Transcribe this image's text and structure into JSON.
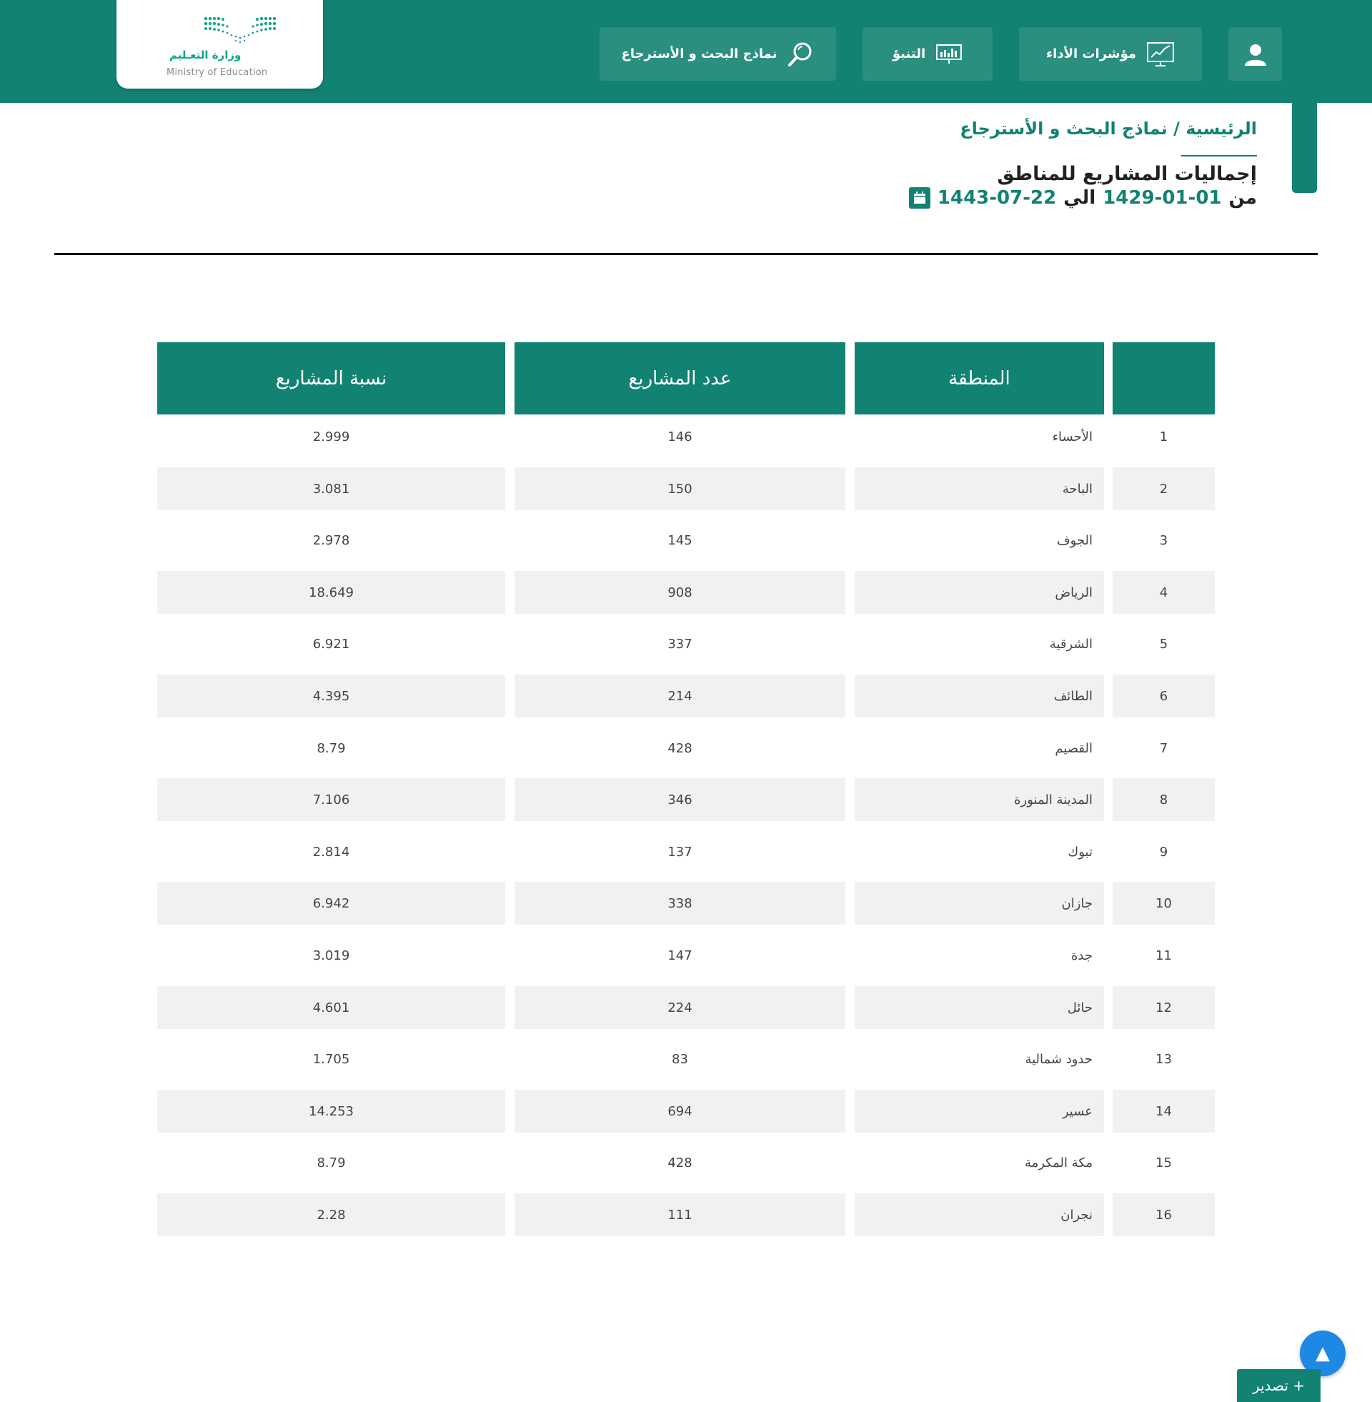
{
  "header": {
    "logo_ar": "وزارة التعـليم",
    "logo_en": "Ministry of Education",
    "nav": [
      {
        "label": "نماذج البحث و الأسترجاع",
        "icon": "search-icon"
      },
      {
        "label": "التنبؤ",
        "icon": "presentation-chart-icon"
      },
      {
        "label": "مؤشرات الأداء",
        "icon": "line-chart-monitor-icon"
      }
    ],
    "user_icon": "user-icon"
  },
  "breadcrumb": {
    "home": "الرئيسية",
    "separator": "/",
    "current": "نماذج البحث و الأسترجاع"
  },
  "report": {
    "title": "إجماليات المشاريع للمناطق",
    "from_label": "من",
    "from_date": "1429-01-01",
    "to_label": "الي",
    "to_date": "1443-07-22",
    "calendar_icon": "calendar-icon"
  },
  "table": {
    "headers": [
      "",
      "المنطقة",
      "عدد المشاريع",
      "نسبة المشاريع"
    ],
    "rows": [
      {
        "idx": "1",
        "region": "الأحساء",
        "count": "146",
        "ratio": "2.999"
      },
      {
        "idx": "2",
        "region": "الباحة",
        "count": "150",
        "ratio": "3.081"
      },
      {
        "idx": "3",
        "region": "الجوف",
        "count": "145",
        "ratio": "2.978"
      },
      {
        "idx": "4",
        "region": "الرياض",
        "count": "908",
        "ratio": "18.649"
      },
      {
        "idx": "5",
        "region": "الشرقية",
        "count": "337",
        "ratio": "6.921"
      },
      {
        "idx": "6",
        "region": "الطائف",
        "count": "214",
        "ratio": "4.395"
      },
      {
        "idx": "7",
        "region": "القصيم",
        "count": "428",
        "ratio": "8.79"
      },
      {
        "idx": "8",
        "region": "المدينة المنورة",
        "count": "346",
        "ratio": "7.106"
      },
      {
        "idx": "9",
        "region": "تبوك",
        "count": "137",
        "ratio": "2.814"
      },
      {
        "idx": "10",
        "region": "جازان",
        "count": "338",
        "ratio": "6.942"
      },
      {
        "idx": "11",
        "region": "جدة",
        "count": "147",
        "ratio": "3.019"
      },
      {
        "idx": "12",
        "region": "حائل",
        "count": "224",
        "ratio": "4.601"
      },
      {
        "idx": "13",
        "region": "حدود شمالية",
        "count": "83",
        "ratio": "1.705"
      },
      {
        "idx": "14",
        "region": "عسير",
        "count": "694",
        "ratio": "14.253"
      },
      {
        "idx": "15",
        "region": "مكة المكرمة",
        "count": "428",
        "ratio": "8.79"
      },
      {
        "idx": "16",
        "region": "نجران",
        "count": "111",
        "ratio": "2.28"
      }
    ]
  },
  "export_label": "+ تصدير",
  "scroll_top_icon": "arrow-up-icon",
  "colors": {
    "primary": "#128272",
    "nav_button": "#2b8f80",
    "row_shade": "#f1f1f1",
    "scroll_button": "#1e88e5"
  }
}
